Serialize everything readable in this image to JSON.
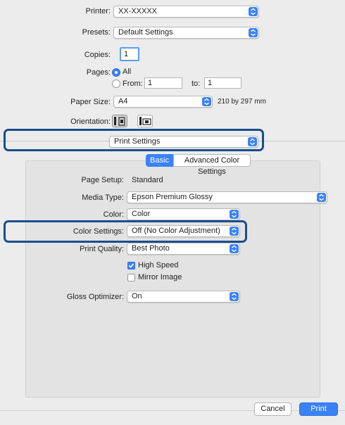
{
  "printer": {
    "label": "Printer:",
    "value": "XX-XXXXX"
  },
  "presets": {
    "label": "Presets:",
    "value": "Default Settings"
  },
  "copies": {
    "label": "Copies:",
    "value": "1"
  },
  "pages": {
    "label": "Pages:",
    "all": "All",
    "from": "From:",
    "from_value": "1",
    "to": "to:",
    "to_value": "1"
  },
  "paper_size": {
    "label": "Paper Size:",
    "value": "A4",
    "dimensions": "210 by 297 mm"
  },
  "orientation": {
    "label": "Orientation:",
    "options": [
      "portrait-icon",
      "landscape-icon"
    ]
  },
  "panel_select": {
    "value": "Print Settings"
  },
  "tabs": [
    {
      "label": "Basic",
      "active": true
    },
    {
      "label": "Advanced Color Settings",
      "active": false
    }
  ],
  "settings": {
    "page_setup": {
      "label": "Page Setup:",
      "value": "Standard"
    },
    "media_type": {
      "label": "Media Type:",
      "value": "Epson Premium Glossy"
    },
    "color": {
      "label": "Color:",
      "value": "Color"
    },
    "color_settings": {
      "label": "Color Settings:",
      "value": "Off (No Color Adjustment)"
    },
    "print_quality": {
      "label": "Print Quality:",
      "value": "Best Photo"
    },
    "high_speed": {
      "label": "High Speed",
      "checked": true
    },
    "mirror_image": {
      "label": "Mirror Image",
      "checked": false
    },
    "gloss_optimizer": {
      "label": "Gloss Optimizer:",
      "value": "On"
    }
  },
  "buttons": {
    "cancel": "Cancel",
    "print": "Print"
  },
  "colors": {
    "accent": "#3b82f6",
    "callout": "#1a4d8f",
    "background": "#ececec"
  }
}
